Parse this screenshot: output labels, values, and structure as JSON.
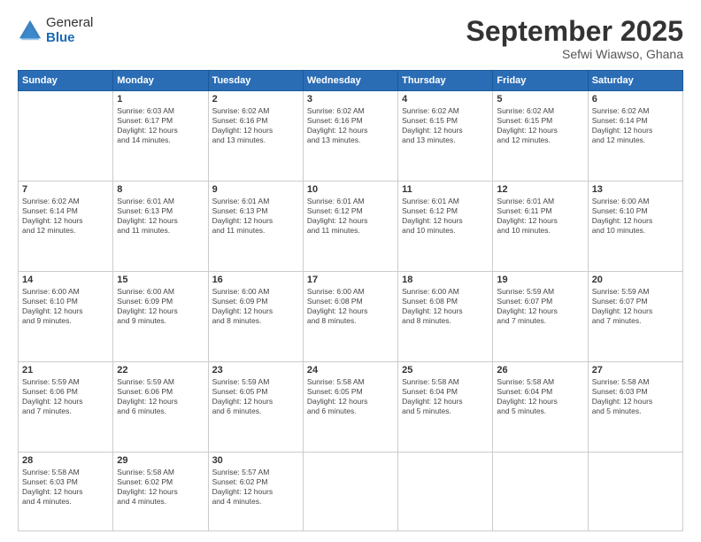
{
  "logo": {
    "general": "General",
    "blue": "Blue"
  },
  "header": {
    "month": "September 2025",
    "location": "Sefwi Wiawso, Ghana"
  },
  "weekdays": [
    "Sunday",
    "Monday",
    "Tuesday",
    "Wednesday",
    "Thursday",
    "Friday",
    "Saturday"
  ],
  "weeks": [
    [
      {
        "day": "",
        "info": ""
      },
      {
        "day": "1",
        "info": "Sunrise: 6:03 AM\nSunset: 6:17 PM\nDaylight: 12 hours\nand 14 minutes."
      },
      {
        "day": "2",
        "info": "Sunrise: 6:02 AM\nSunset: 6:16 PM\nDaylight: 12 hours\nand 13 minutes."
      },
      {
        "day": "3",
        "info": "Sunrise: 6:02 AM\nSunset: 6:16 PM\nDaylight: 12 hours\nand 13 minutes."
      },
      {
        "day": "4",
        "info": "Sunrise: 6:02 AM\nSunset: 6:15 PM\nDaylight: 12 hours\nand 13 minutes."
      },
      {
        "day": "5",
        "info": "Sunrise: 6:02 AM\nSunset: 6:15 PM\nDaylight: 12 hours\nand 12 minutes."
      },
      {
        "day": "6",
        "info": "Sunrise: 6:02 AM\nSunset: 6:14 PM\nDaylight: 12 hours\nand 12 minutes."
      }
    ],
    [
      {
        "day": "7",
        "info": "Sunrise: 6:02 AM\nSunset: 6:14 PM\nDaylight: 12 hours\nand 12 minutes."
      },
      {
        "day": "8",
        "info": "Sunrise: 6:01 AM\nSunset: 6:13 PM\nDaylight: 12 hours\nand 11 minutes."
      },
      {
        "day": "9",
        "info": "Sunrise: 6:01 AM\nSunset: 6:13 PM\nDaylight: 12 hours\nand 11 minutes."
      },
      {
        "day": "10",
        "info": "Sunrise: 6:01 AM\nSunset: 6:12 PM\nDaylight: 12 hours\nand 11 minutes."
      },
      {
        "day": "11",
        "info": "Sunrise: 6:01 AM\nSunset: 6:12 PM\nDaylight: 12 hours\nand 10 minutes."
      },
      {
        "day": "12",
        "info": "Sunrise: 6:01 AM\nSunset: 6:11 PM\nDaylight: 12 hours\nand 10 minutes."
      },
      {
        "day": "13",
        "info": "Sunrise: 6:00 AM\nSunset: 6:10 PM\nDaylight: 12 hours\nand 10 minutes."
      }
    ],
    [
      {
        "day": "14",
        "info": "Sunrise: 6:00 AM\nSunset: 6:10 PM\nDaylight: 12 hours\nand 9 minutes."
      },
      {
        "day": "15",
        "info": "Sunrise: 6:00 AM\nSunset: 6:09 PM\nDaylight: 12 hours\nand 9 minutes."
      },
      {
        "day": "16",
        "info": "Sunrise: 6:00 AM\nSunset: 6:09 PM\nDaylight: 12 hours\nand 8 minutes."
      },
      {
        "day": "17",
        "info": "Sunrise: 6:00 AM\nSunset: 6:08 PM\nDaylight: 12 hours\nand 8 minutes."
      },
      {
        "day": "18",
        "info": "Sunrise: 6:00 AM\nSunset: 6:08 PM\nDaylight: 12 hours\nand 8 minutes."
      },
      {
        "day": "19",
        "info": "Sunrise: 5:59 AM\nSunset: 6:07 PM\nDaylight: 12 hours\nand 7 minutes."
      },
      {
        "day": "20",
        "info": "Sunrise: 5:59 AM\nSunset: 6:07 PM\nDaylight: 12 hours\nand 7 minutes."
      }
    ],
    [
      {
        "day": "21",
        "info": "Sunrise: 5:59 AM\nSunset: 6:06 PM\nDaylight: 12 hours\nand 7 minutes."
      },
      {
        "day": "22",
        "info": "Sunrise: 5:59 AM\nSunset: 6:06 PM\nDaylight: 12 hours\nand 6 minutes."
      },
      {
        "day": "23",
        "info": "Sunrise: 5:59 AM\nSunset: 6:05 PM\nDaylight: 12 hours\nand 6 minutes."
      },
      {
        "day": "24",
        "info": "Sunrise: 5:58 AM\nSunset: 6:05 PM\nDaylight: 12 hours\nand 6 minutes."
      },
      {
        "day": "25",
        "info": "Sunrise: 5:58 AM\nSunset: 6:04 PM\nDaylight: 12 hours\nand 5 minutes."
      },
      {
        "day": "26",
        "info": "Sunrise: 5:58 AM\nSunset: 6:04 PM\nDaylight: 12 hours\nand 5 minutes."
      },
      {
        "day": "27",
        "info": "Sunrise: 5:58 AM\nSunset: 6:03 PM\nDaylight: 12 hours\nand 5 minutes."
      }
    ],
    [
      {
        "day": "28",
        "info": "Sunrise: 5:58 AM\nSunset: 6:03 PM\nDaylight: 12 hours\nand 4 minutes."
      },
      {
        "day": "29",
        "info": "Sunrise: 5:58 AM\nSunset: 6:02 PM\nDaylight: 12 hours\nand 4 minutes."
      },
      {
        "day": "30",
        "info": "Sunrise: 5:57 AM\nSunset: 6:02 PM\nDaylight: 12 hours\nand 4 minutes."
      },
      {
        "day": "",
        "info": ""
      },
      {
        "day": "",
        "info": ""
      },
      {
        "day": "",
        "info": ""
      },
      {
        "day": "",
        "info": ""
      }
    ]
  ]
}
